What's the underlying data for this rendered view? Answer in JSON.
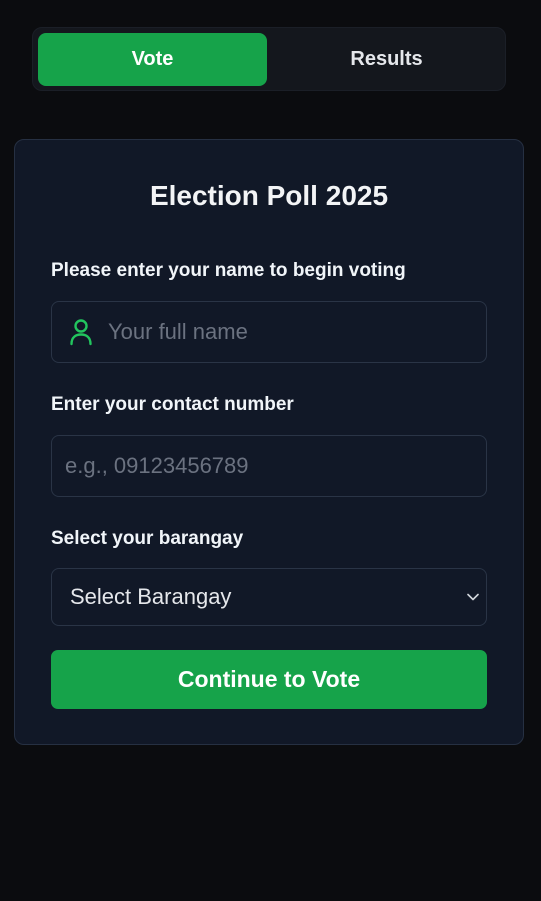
{
  "tabs": [
    {
      "label": "Vote",
      "active": true
    },
    {
      "label": "Results",
      "active": false
    }
  ],
  "form": {
    "title": "Election Poll 2025",
    "name_label": "Please enter your name to begin voting",
    "name_placeholder": "Your full name",
    "name_icon": "person-icon",
    "contact_label": "Enter your contact number",
    "contact_placeholder": "e.g., 09123456789",
    "barangay_label": "Select your barangay",
    "barangay_selected": "Select Barangay",
    "barangay_icon": "chevron-down-icon",
    "submit_label": "Continue to Vote"
  },
  "colors": {
    "accent": "#16a34a",
    "card_background": "#111827",
    "page_background": "#0b0c0f"
  }
}
